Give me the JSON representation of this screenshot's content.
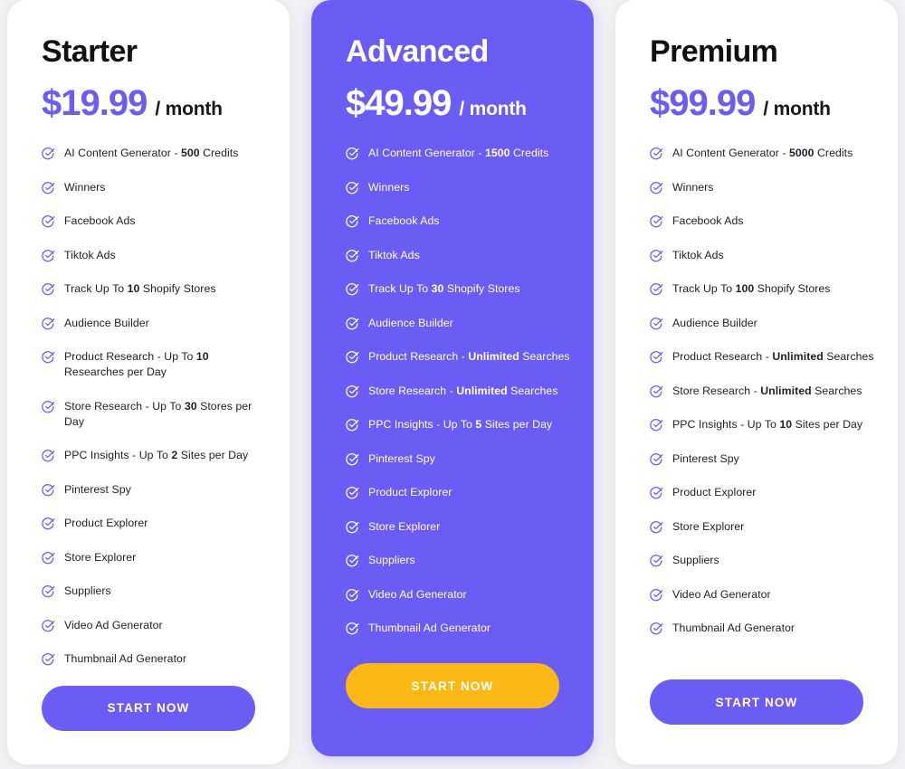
{
  "theme": {
    "brand_purple": "#6C5CF6",
    "accent_yellow": "#FCB815",
    "page_bg": "#F2F2F4",
    "card_bg": "#FFFFFF",
    "text_dark": "#111014"
  },
  "plans": [
    {
      "name": "Starter",
      "price": "$19.99",
      "period": "/ month",
      "featured": false,
      "cta_label": "START NOW",
      "cta_style": "purple",
      "features": [
        {
          "parts": [
            {
              "t": "AI Content Generator - ",
              "b": false
            },
            {
              "t": "500",
              "b": true
            },
            {
              "t": " Credits",
              "b": false
            }
          ]
        },
        {
          "parts": [
            {
              "t": "Winners",
              "b": false
            }
          ]
        },
        {
          "parts": [
            {
              "t": "Facebook Ads",
              "b": false
            }
          ]
        },
        {
          "parts": [
            {
              "t": "Tiktok Ads",
              "b": false
            }
          ]
        },
        {
          "parts": [
            {
              "t": "Track Up To ",
              "b": false
            },
            {
              "t": "10",
              "b": true
            },
            {
              "t": " Shopify Stores",
              "b": false
            }
          ]
        },
        {
          "parts": [
            {
              "t": "Audience Builder",
              "b": false
            }
          ]
        },
        {
          "parts": [
            {
              "t": "Product Research - Up To ",
              "b": false
            },
            {
              "t": "10",
              "b": true
            },
            {
              "t": " Researches per Day",
              "b": false
            }
          ]
        },
        {
          "parts": [
            {
              "t": "Store Research - Up To ",
              "b": false
            },
            {
              "t": "30",
              "b": true
            },
            {
              "t": " Stores per Day",
              "b": false
            }
          ]
        },
        {
          "parts": [
            {
              "t": "PPC Insights - Up To ",
              "b": false
            },
            {
              "t": "2",
              "b": true
            },
            {
              "t": " Sites per Day",
              "b": false
            }
          ]
        },
        {
          "parts": [
            {
              "t": "Pinterest Spy",
              "b": false
            }
          ]
        },
        {
          "parts": [
            {
              "t": "Product Explorer",
              "b": false
            }
          ]
        },
        {
          "parts": [
            {
              "t": "Store Explorer",
              "b": false
            }
          ]
        },
        {
          "parts": [
            {
              "t": "Suppliers",
              "b": false
            }
          ]
        },
        {
          "parts": [
            {
              "t": "Video Ad Generator",
              "b": false
            }
          ]
        },
        {
          "parts": [
            {
              "t": "Thumbnail Ad Generator",
              "b": false
            }
          ]
        }
      ]
    },
    {
      "name": "Advanced",
      "price": "$49.99",
      "period": "/ month",
      "featured": true,
      "cta_label": "START NOW",
      "cta_style": "yellow",
      "features": [
        {
          "parts": [
            {
              "t": "AI Content Generator - ",
              "b": false
            },
            {
              "t": "1500",
              "b": true
            },
            {
              "t": " Credits",
              "b": false
            }
          ]
        },
        {
          "parts": [
            {
              "t": "Winners",
              "b": false
            }
          ]
        },
        {
          "parts": [
            {
              "t": "Facebook Ads",
              "b": false
            }
          ]
        },
        {
          "parts": [
            {
              "t": "Tiktok Ads",
              "b": false
            }
          ]
        },
        {
          "parts": [
            {
              "t": "Track Up To ",
              "b": false
            },
            {
              "t": "30",
              "b": true
            },
            {
              "t": " Shopify Stores",
              "b": false
            }
          ]
        },
        {
          "parts": [
            {
              "t": "Audience Builder",
              "b": false
            }
          ]
        },
        {
          "parts": [
            {
              "t": "Product Research - ",
              "b": false
            },
            {
              "t": "Unlimited",
              "b": true
            },
            {
              "t": " Searches",
              "b": false
            }
          ]
        },
        {
          "parts": [
            {
              "t": "Store Research - ",
              "b": false
            },
            {
              "t": "Unlimited",
              "b": true
            },
            {
              "t": " Searches",
              "b": false
            }
          ]
        },
        {
          "parts": [
            {
              "t": "PPC Insights - Up To ",
              "b": false
            },
            {
              "t": "5",
              "b": true
            },
            {
              "t": " Sites per Day",
              "b": false
            }
          ]
        },
        {
          "parts": [
            {
              "t": "Pinterest Spy",
              "b": false
            }
          ]
        },
        {
          "parts": [
            {
              "t": "Product Explorer",
              "b": false
            }
          ]
        },
        {
          "parts": [
            {
              "t": "Store Explorer",
              "b": false
            }
          ]
        },
        {
          "parts": [
            {
              "t": "Suppliers",
              "b": false
            }
          ]
        },
        {
          "parts": [
            {
              "t": "Video Ad Generator",
              "b": false
            }
          ]
        },
        {
          "parts": [
            {
              "t": "Thumbnail Ad Generator",
              "b": false
            }
          ]
        }
      ]
    },
    {
      "name": "Premium",
      "price": "$99.99",
      "period": "/ month",
      "featured": false,
      "cta_label": "START NOW",
      "cta_style": "purple",
      "features": [
        {
          "parts": [
            {
              "t": "AI Content Generator - ",
              "b": false
            },
            {
              "t": "5000",
              "b": true
            },
            {
              "t": " Credits",
              "b": false
            }
          ]
        },
        {
          "parts": [
            {
              "t": "Winners",
              "b": false
            }
          ]
        },
        {
          "parts": [
            {
              "t": "Facebook Ads",
              "b": false
            }
          ]
        },
        {
          "parts": [
            {
              "t": "Tiktok Ads",
              "b": false
            }
          ]
        },
        {
          "parts": [
            {
              "t": "Track Up To ",
              "b": false
            },
            {
              "t": "100",
              "b": true
            },
            {
              "t": " Shopify Stores",
              "b": false
            }
          ]
        },
        {
          "parts": [
            {
              "t": "Audience Builder",
              "b": false
            }
          ]
        },
        {
          "parts": [
            {
              "t": "Product Research - ",
              "b": false
            },
            {
              "t": "Unlimited",
              "b": true
            },
            {
              "t": " Searches",
              "b": false
            }
          ]
        },
        {
          "parts": [
            {
              "t": "Store Research - ",
              "b": false
            },
            {
              "t": "Unlimited",
              "b": true
            },
            {
              "t": " Searches",
              "b": false
            }
          ]
        },
        {
          "parts": [
            {
              "t": "PPC Insights - Up To ",
              "b": false
            },
            {
              "t": "10",
              "b": true
            },
            {
              "t": " Sites per Day",
              "b": false
            }
          ]
        },
        {
          "parts": [
            {
              "t": "Pinterest Spy",
              "b": false
            }
          ]
        },
        {
          "parts": [
            {
              "t": "Product Explorer",
              "b": false
            }
          ]
        },
        {
          "parts": [
            {
              "t": "Store Explorer",
              "b": false
            }
          ]
        },
        {
          "parts": [
            {
              "t": "Suppliers",
              "b": false
            }
          ]
        },
        {
          "parts": [
            {
              "t": "Video Ad Generator",
              "b": false
            }
          ]
        },
        {
          "parts": [
            {
              "t": "Thumbnail Ad Generator",
              "b": false
            }
          ]
        }
      ]
    }
  ],
  "icons": {
    "check": "check-circle-icon"
  }
}
